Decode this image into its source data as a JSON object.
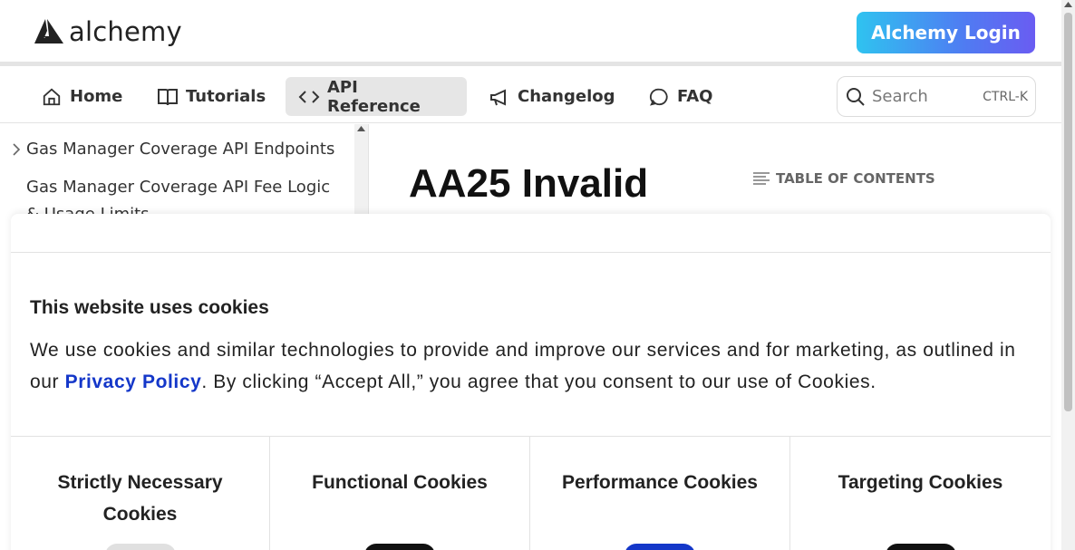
{
  "header": {
    "logo_text": "alchemy",
    "login_label": "Alchemy Login"
  },
  "nav": {
    "items": [
      {
        "label": "Home",
        "icon": "home-icon"
      },
      {
        "label": "Tutorials",
        "icon": "book-icon"
      },
      {
        "label": "API Reference",
        "icon": "code-icon",
        "active": true
      },
      {
        "label": "Changelog",
        "icon": "megaphone-icon"
      },
      {
        "label": "FAQ",
        "icon": "chat-bubble-icon"
      }
    ],
    "search_placeholder": "Search",
    "search_shortcut": "CTRL-K"
  },
  "sidebar": {
    "items": [
      {
        "label": "Gas Manager Coverage API Endpoints"
      },
      {
        "label": "Gas Manager Coverage API Fee Logic"
      },
      {
        "label": "& Usage Limits"
      }
    ]
  },
  "main": {
    "title": "AA25 Invalid",
    "toc_label": "TABLE OF CONTENTS"
  },
  "cookie_banner": {
    "title": "This website uses cookies",
    "text_before_link": "We use cookies and similar technologies to provide and improve our services and for marketing, as outlined in our ",
    "link_label": "Privacy Policy",
    "text_after_link": ". By clicking “Accept All,” you agree that you consent to our use of Cookies.",
    "categories": [
      {
        "label": "Strictly Necessary Cookies",
        "toggle_color": "#e0e0e0"
      },
      {
        "label": "Functional Cookies",
        "toggle_color": "#111111"
      },
      {
        "label": "Performance Cookies",
        "toggle_color": "#1437c9"
      },
      {
        "label": "Targeting Cookies",
        "toggle_color": "#111111"
      }
    ]
  },
  "colors": {
    "login_gradient_start": "#2fc3f0",
    "login_gradient_end": "#6a5cf2",
    "link": "#1437c9",
    "nav_active_bg": "#e6e6e6"
  }
}
